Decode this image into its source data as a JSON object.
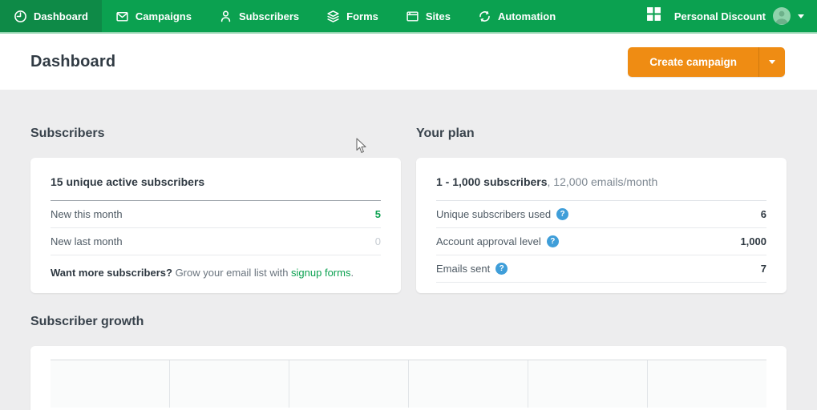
{
  "navbar": {
    "items": [
      {
        "label": "Dashboard",
        "icon": "clock-icon",
        "active": true
      },
      {
        "label": "Campaigns",
        "icon": "envelope-icon",
        "active": false
      },
      {
        "label": "Subscribers",
        "icon": "person-icon",
        "active": false
      },
      {
        "label": "Forms",
        "icon": "layers-icon",
        "active": false
      },
      {
        "label": "Sites",
        "icon": "browser-icon",
        "active": false
      },
      {
        "label": "Automation",
        "icon": "sync-icon",
        "active": false
      }
    ],
    "account_name": "Personal Discount"
  },
  "header": {
    "title": "Dashboard",
    "create_campaign_label": "Create campaign"
  },
  "subscribers_section": {
    "heading": "Subscribers",
    "card": {
      "title": "15 unique active subscribers",
      "rows": [
        {
          "label": "New this month",
          "value": "5"
        },
        {
          "label": "New last month",
          "value": "0"
        }
      ],
      "footer_bold": "Want more subscribers?",
      "footer_text": " Grow your email list with ",
      "footer_link": "signup forms",
      "footer_period": "."
    }
  },
  "plan_section": {
    "heading": "Your plan",
    "help_glyph": "?",
    "card": {
      "title_bold": "1 - 1,000 subscribers",
      "title_rest": ", 12,000 emails/month",
      "rows": [
        {
          "label": "Unique subscribers used",
          "value": "6"
        },
        {
          "label": "Account approval level",
          "value": "1,000"
        },
        {
          "label": "Emails sent",
          "value": "7"
        }
      ]
    }
  },
  "growth_section": {
    "heading": "Subscriber growth",
    "segments": 6
  },
  "colors": {
    "brand_green": "#0ba150",
    "nav_active_green": "#0e8a47",
    "accent_orange": "#ef8c13",
    "link_green": "#0ba150",
    "help_blue": "#3f9ed9",
    "positive_value_green": "#0ba150",
    "body_background": "#ededee"
  }
}
